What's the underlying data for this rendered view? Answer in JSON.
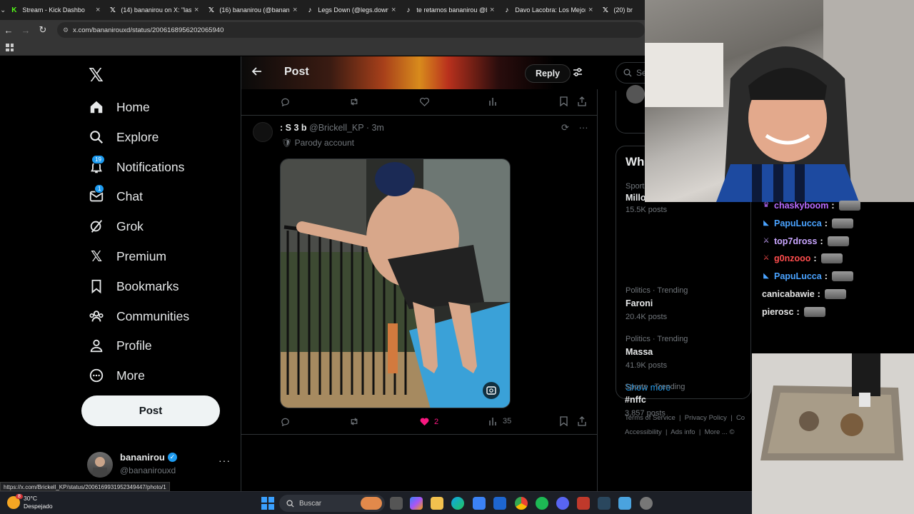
{
  "browser": {
    "tabs": [
      {
        "title": "Stream - Kick Dashbo",
        "favicon": "kick-icon",
        "color": "#53fc18",
        "glyph": "K"
      },
      {
        "title": "(14) bananirou on X: \"las p",
        "favicon": "x-icon",
        "color": "#ffffff",
        "glyph": "𝕏"
      },
      {
        "title": "(16) bananirou (@banani",
        "favicon": "x-icon",
        "color": "#ffffff",
        "glyph": "𝕏"
      },
      {
        "title": "Legs Down (@legs.down)",
        "favicon": "tiktok-icon",
        "color": "#ffffff",
        "glyph": "♪"
      },
      {
        "title": "te retamos bananirou @b",
        "favicon": "tiktok-icon",
        "color": "#ffffff",
        "glyph": "♪"
      },
      {
        "title": "Davo Lacobra: Los Mejore",
        "favicon": "tiktok-icon",
        "color": "#ffffff",
        "glyph": "♪"
      },
      {
        "title": "(20) br",
        "favicon": "x-icon",
        "color": "#ffffff",
        "glyph": "𝕏"
      }
    ],
    "url": "x.com/bananirouxd/status/2006168956202065940"
  },
  "nav": {
    "items": [
      {
        "label": "Home",
        "icon": "home-icon"
      },
      {
        "label": "Explore",
        "icon": "search-icon"
      },
      {
        "label": "Notifications",
        "icon": "bell-icon",
        "badge": "19"
      },
      {
        "label": "Chat",
        "icon": "mail-icon",
        "badge": "1"
      },
      {
        "label": "Grok",
        "icon": "grok-icon"
      },
      {
        "label": "Premium",
        "icon": "x-icon"
      },
      {
        "label": "Bookmarks",
        "icon": "bookmark-icon"
      },
      {
        "label": "Communities",
        "icon": "communities-icon"
      },
      {
        "label": "Profile",
        "icon": "person-icon"
      },
      {
        "label": "More",
        "icon": "more-circle-icon"
      }
    ],
    "post_label": "Post",
    "account": {
      "name": "bananirou",
      "handle": "@bananirouxd"
    }
  },
  "main": {
    "title": "Post",
    "reply_label": "Reply",
    "tweet": {
      "name": ": S 3 b",
      "handle": "@Brickell_KP · 3m",
      "parody": "Parody account",
      "likes": "2",
      "views": "35"
    }
  },
  "sidebar": {
    "search_placeholder": "Se",
    "card_title": "Wh",
    "partial_trend": {
      "meta": "Sport",
      "name": "Millo",
      "count": "15.5K posts"
    },
    "trends": [
      {
        "meta": "Politics · Trending",
        "name": "Faroni",
        "count": "20.4K posts"
      },
      {
        "meta": "Politics · Trending",
        "name": "Massa",
        "count": "41.9K posts"
      },
      {
        "meta": "Sports · Trending",
        "name": "#nffc",
        "count": "3,857 posts"
      }
    ],
    "show_more": "Show more",
    "footer": {
      "terms": "Terms of Service",
      "privacy": "Privacy Policy",
      "cookie": "Co",
      "accessibility": "Accessibility",
      "ads": "Ads info",
      "more": "More ...",
      "copyright": "©"
    }
  },
  "stream_chat": [
    {
      "user": "chaskyboom",
      "color": "#b86bff",
      "badge": "prime"
    },
    {
      "user": "PapuLucca",
      "color": "#4aa3ff",
      "badge": "sub"
    },
    {
      "user": "top7dross",
      "color": "#c9a6ff",
      "badge": "sword"
    },
    {
      "user": "g0nzooo",
      "color": "#ff4d4d",
      "badge": "sword"
    },
    {
      "user": "PapuLucca",
      "color": "#4aa3ff",
      "badge": "sub"
    },
    {
      "user": "canicabawie",
      "color": "#e6e6e6",
      "badge": ""
    },
    {
      "user": "pierosc",
      "color": "#e6e6e6",
      "badge": ""
    }
  ],
  "status_url": "https://x.com/Brickell_KP/status/2006169931952349447/photo/1",
  "taskbar": {
    "temperature": "30°C",
    "weather": "Despejado",
    "weather_badge": "8",
    "search_label": "Buscar"
  },
  "colors": {
    "accent": "#1d9bf0",
    "like": "#f91880"
  }
}
